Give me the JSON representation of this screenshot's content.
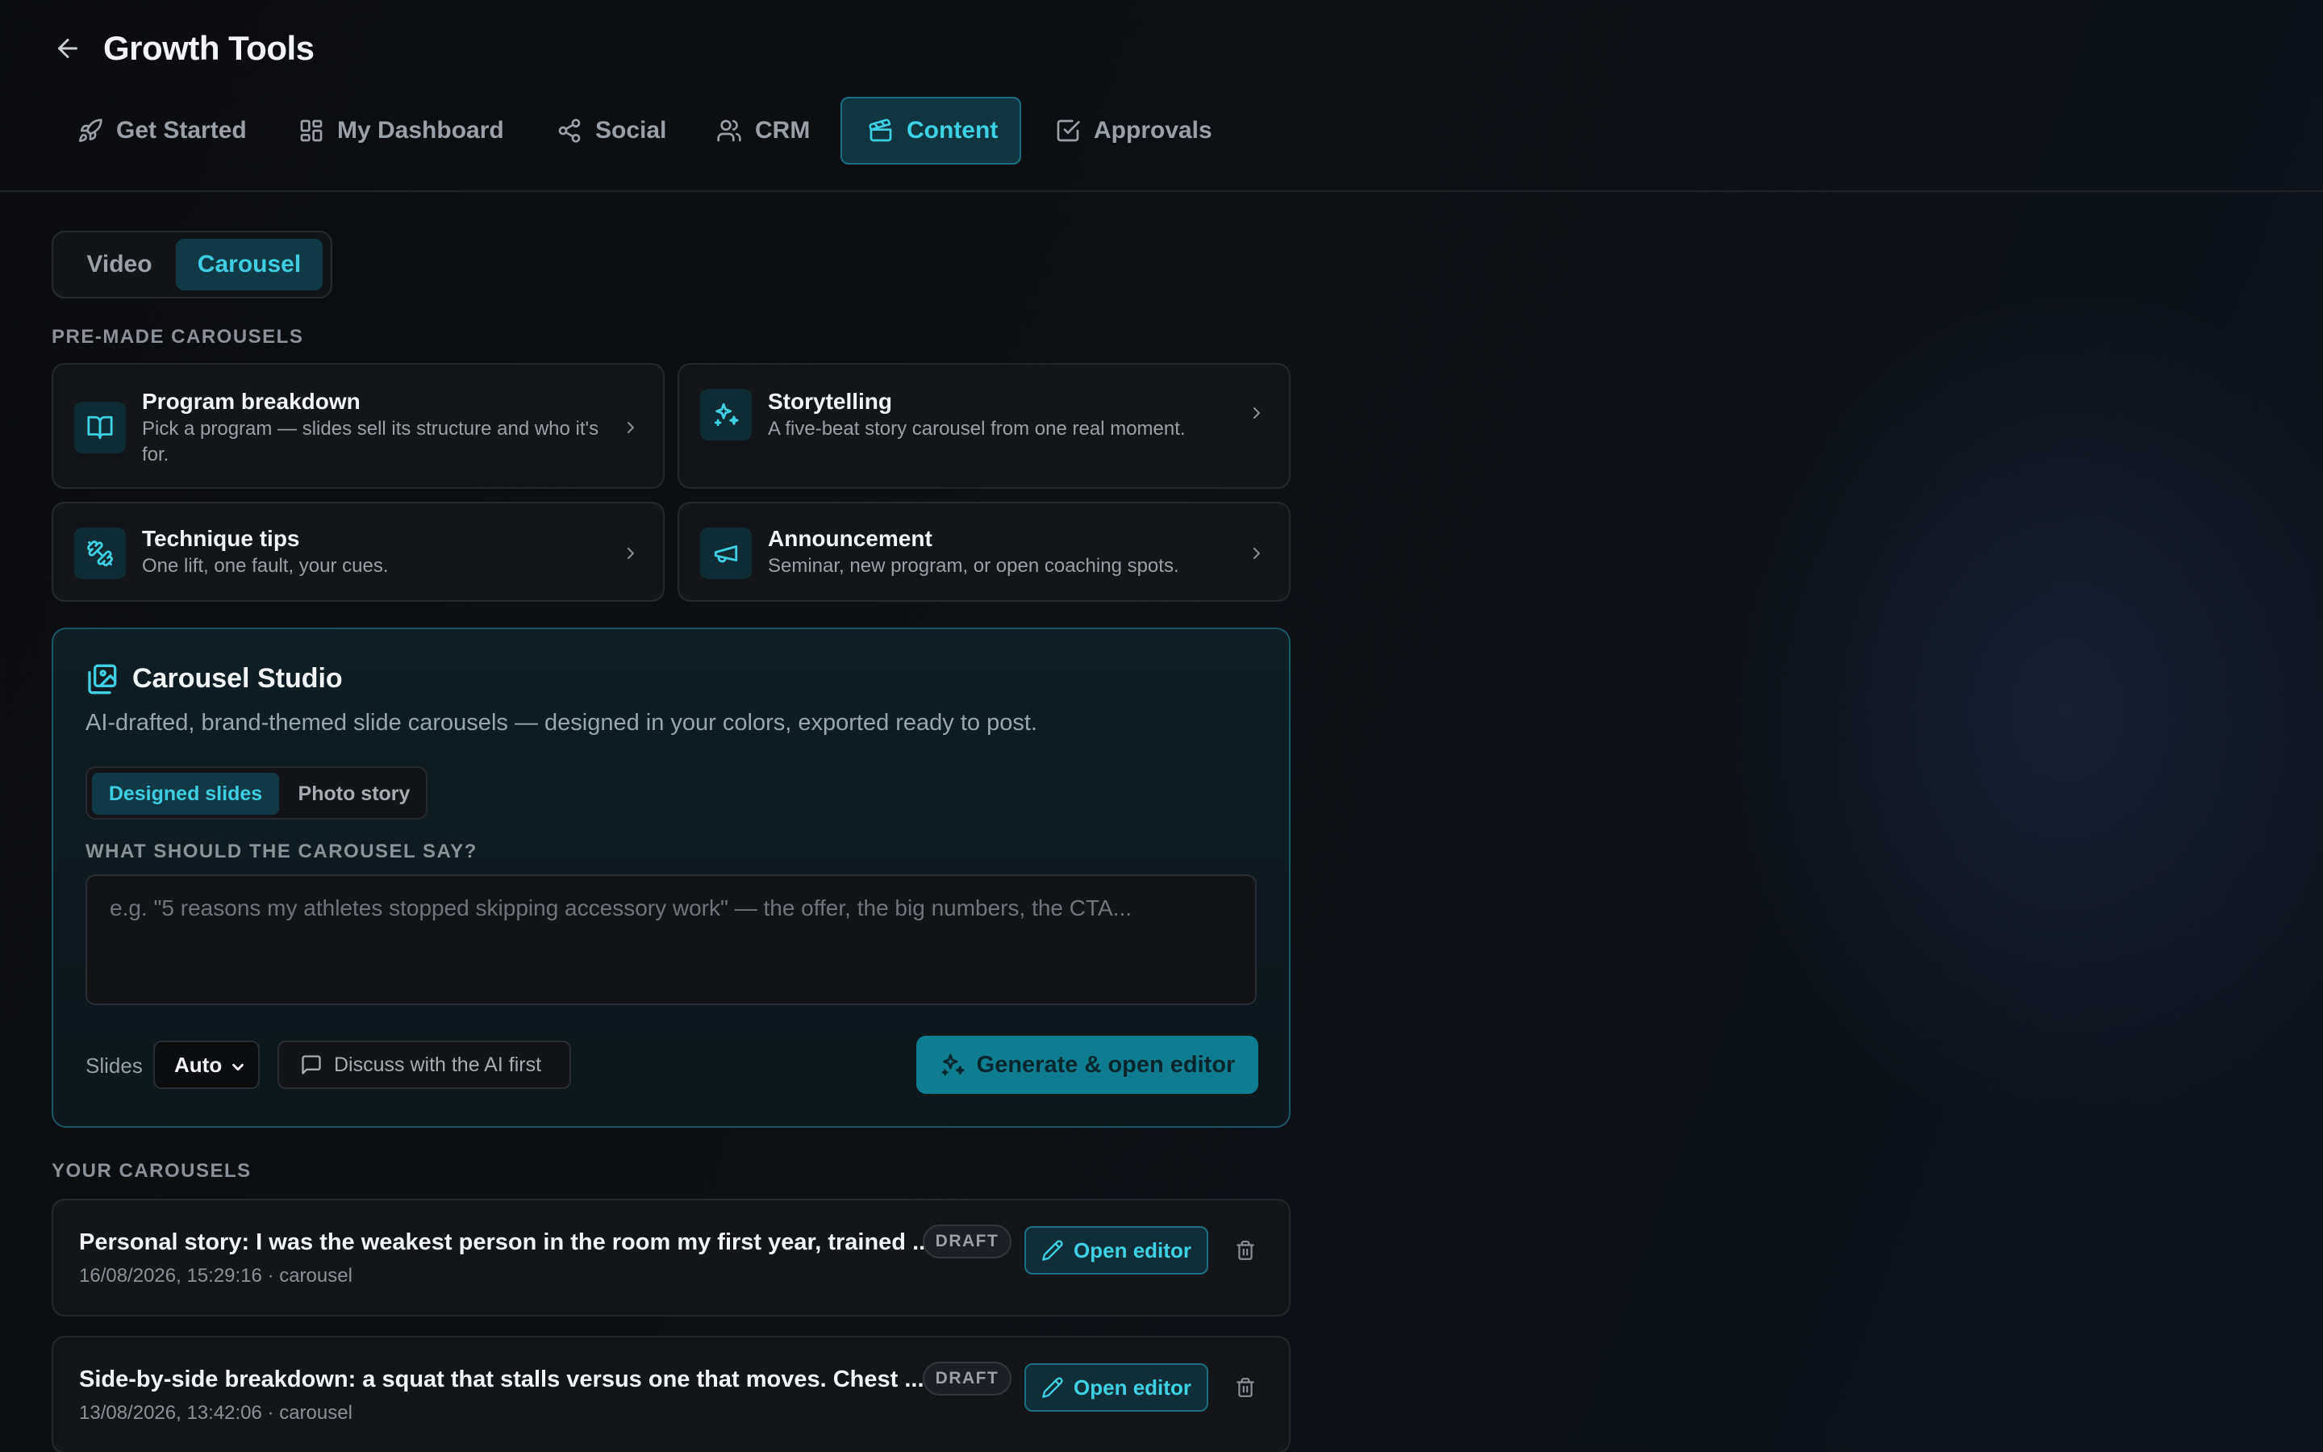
{
  "header": {
    "title": "Growth Tools"
  },
  "tabs": [
    {
      "label": "Get Started",
      "icon": "rocket-icon"
    },
    {
      "label": "My Dashboard",
      "icon": "grid-icon"
    },
    {
      "label": "Social",
      "icon": "share-icon"
    },
    {
      "label": "CRM",
      "icon": "users-icon"
    },
    {
      "label": "Content",
      "icon": "clapperboard-icon",
      "active": true
    },
    {
      "label": "Approvals",
      "icon": "check-square-icon"
    }
  ],
  "content_type": {
    "options": [
      "Video",
      "Carousel"
    ],
    "selected": "Carousel"
  },
  "premade": {
    "heading": "PRE-MADE CAROUSELS",
    "items": [
      {
        "title": "Program breakdown",
        "description": "Pick a program — slides sell its structure and who it's for.",
        "icon": "book-open-icon"
      },
      {
        "title": "Storytelling",
        "description": "A five-beat story carousel from one real moment.",
        "icon": "sparkles-icon"
      },
      {
        "title": "Technique tips",
        "description": "One lift, one fault, your cues.",
        "icon": "dumbbell-icon"
      },
      {
        "title": "Announcement",
        "description": "Seminar, new program, or open coaching spots.",
        "icon": "megaphone-icon"
      }
    ]
  },
  "studio": {
    "title": "Carousel Studio",
    "subtitle": "AI-drafted, brand-themed slide carousels — designed in your colors, exported ready to post.",
    "modes": [
      "Designed slides",
      "Photo story"
    ],
    "selected_mode": "Designed slides",
    "prompt_label": "WHAT SHOULD THE CAROUSEL SAY?",
    "prompt_value": "",
    "prompt_placeholder": "e.g. \"5 reasons my athletes stopped skipping accessory work\" — the offer, the big numbers, the CTA...",
    "slides_label": "Slides",
    "slides_value": "Auto",
    "discuss_label": "Discuss with the AI first",
    "generate_label": "Generate & open editor",
    "accent": "#0e7d92"
  },
  "carousels": {
    "heading": "YOUR CAROUSELS",
    "items": [
      {
        "title": "Personal story: I was the weakest person in the room my first year, trained ...",
        "meta": "16/08/2026, 15:29:16 · carousel",
        "status": "DRAFT",
        "action": "Open editor"
      },
      {
        "title": "Side-by-side breakdown: a squat that stalls versus one that moves. Chest ...",
        "meta": "13/08/2026, 13:42:06 · carousel",
        "status": "DRAFT",
        "action": "Open editor"
      }
    ]
  }
}
